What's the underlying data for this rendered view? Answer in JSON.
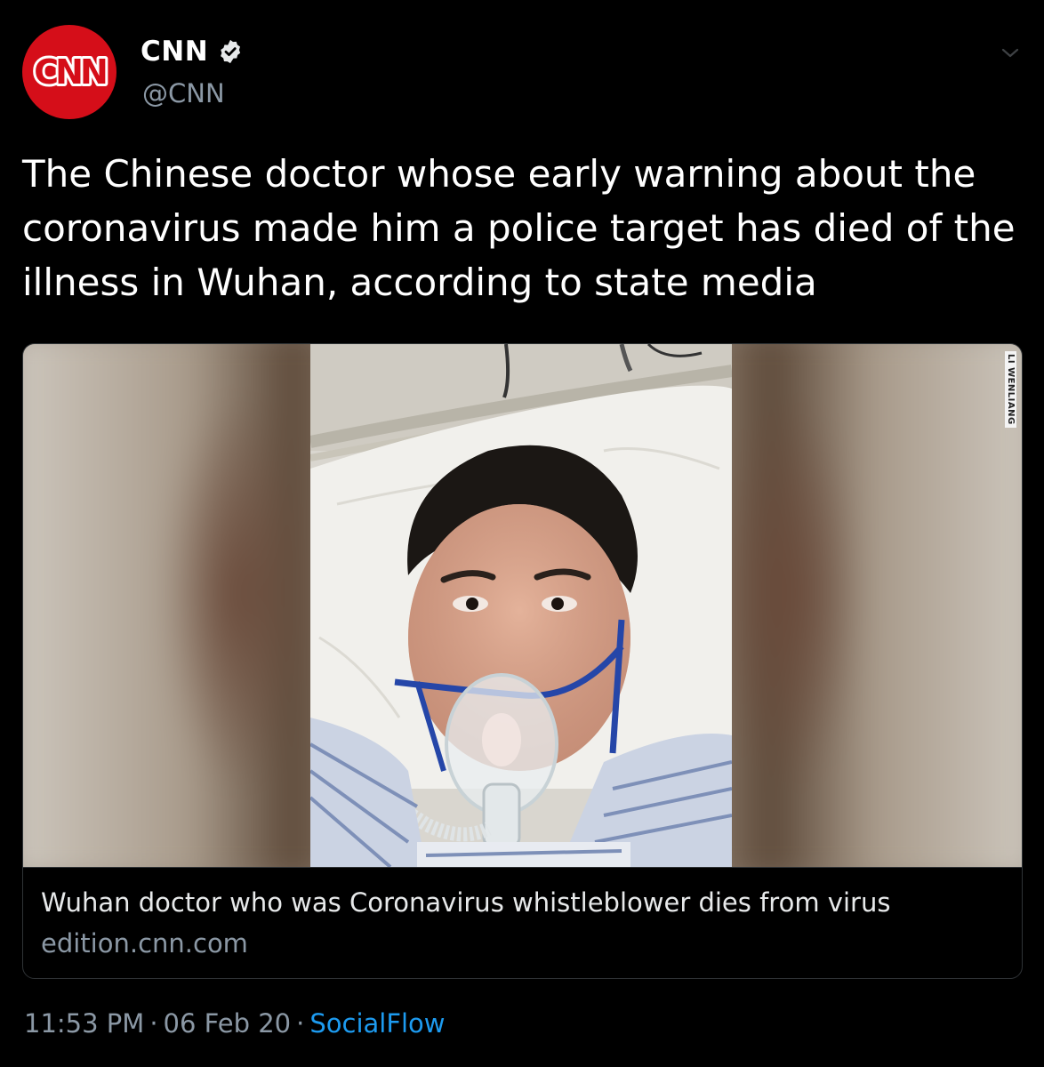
{
  "tweet": {
    "author": {
      "display_name": "CNN",
      "handle": "@CNN",
      "avatar_text": "CNN",
      "verified": true
    },
    "text": "The Chinese doctor whose early warning about the coronavirus made him a police target has died of the illness in Wuhan, according to state media",
    "card": {
      "title": "Wuhan doctor who was Coronavirus whistleblower dies from virus",
      "domain": "edition.cnn.com",
      "image_credit": "LI WENLIANG"
    },
    "meta": {
      "time": "11:53 PM",
      "date": "06 Feb 20",
      "separator": "·",
      "source": "SocialFlow"
    }
  },
  "colors": {
    "background": "#000000",
    "text_primary": "#ffffff",
    "text_secondary": "#8b98a5",
    "link": "#1d9bf0",
    "brand_red": "#d50e19",
    "border": "#2f3336"
  },
  "icons": {
    "verified": "verified-badge-icon",
    "menu": "chevron-down-icon"
  }
}
